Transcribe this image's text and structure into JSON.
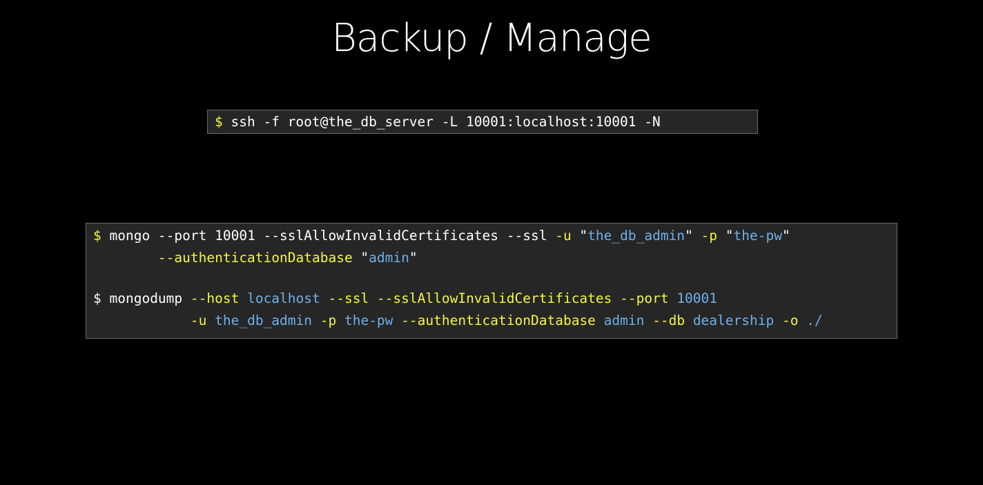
{
  "title": "Backup / Manage",
  "colors": {
    "background": "#000000",
    "code_background": "#262626",
    "flag_yellow": "#f5f542",
    "value_blue": "#6fb0ea",
    "text_white": "#ffffff"
  },
  "ssh_block": {
    "prompt": "$",
    "command": " ssh -f root@the_db_server -L 10001:localhost:10001 -N"
  },
  "mongo_block": {
    "line1": {
      "prompt": "$",
      "command": " mongo --port 10001 --sslAllowInvalidCertificates --ssl ",
      "u_flag": "-u",
      "q1": " \"",
      "u_value": "the_db_admin",
      "q2": "\" ",
      "p_flag": "-p",
      "q3": " \"",
      "p_value": "the-pw",
      "q4": "\""
    },
    "line2": {
      "indent": "        ",
      "auth_flag": "--authenticationDatabase",
      "q1": " \"",
      "auth_value": "admin",
      "q2": "\""
    }
  },
  "mongodump_block": {
    "line1": {
      "prompt": "$",
      "command": " mongodump ",
      "host_flag": "--host",
      "host_value": " localhost",
      "ssl_flags": " --ssl --sslAllowInvalidCertificates --port",
      "port_value": " 10001"
    },
    "line2": {
      "indent": "            ",
      "u_flag": "-u",
      "u_value": " the_db_admin",
      "p_flag": " -p",
      "p_value": " the-pw",
      "auth_flag": " --authenticationDatabase",
      "auth_value": " admin",
      "db_flag": " --db",
      "db_value": " dealership",
      "o_flag": " -o",
      "o_value": " ./"
    }
  }
}
